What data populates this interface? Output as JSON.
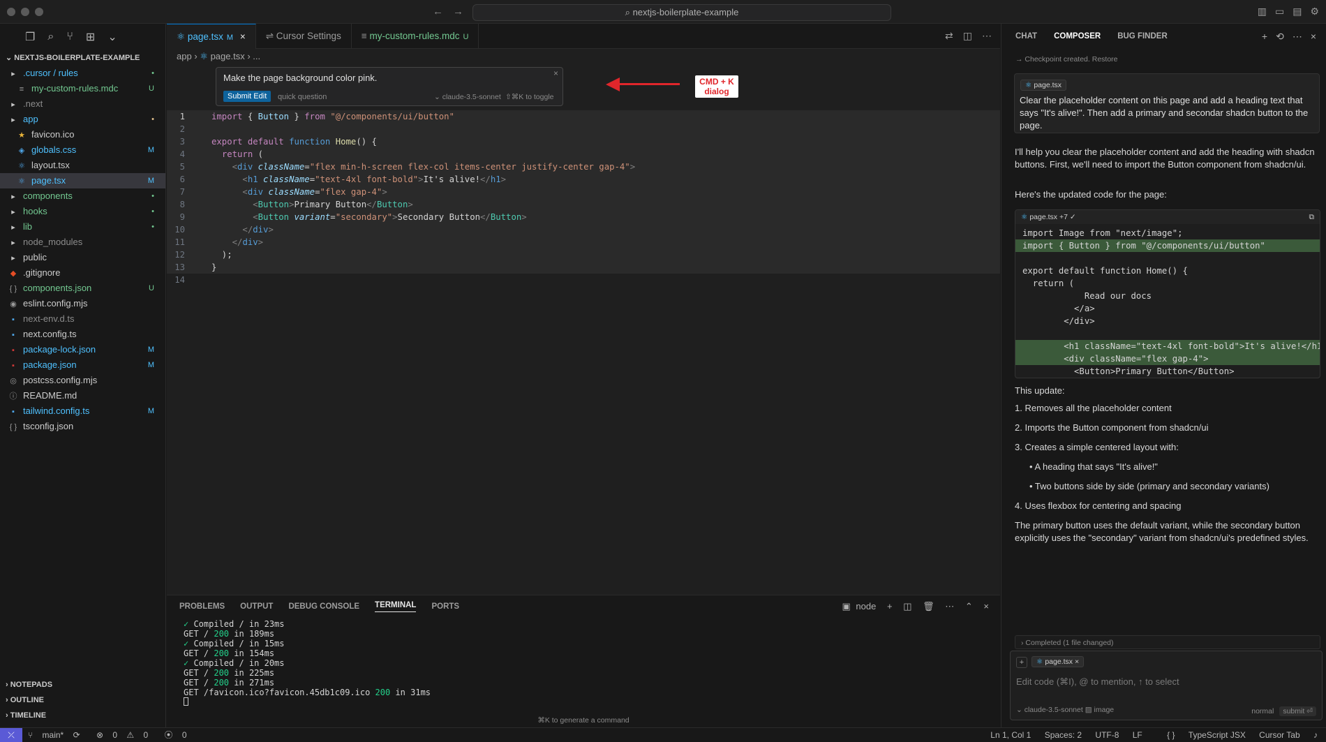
{
  "window": {
    "search_text": "nextjs-boilerplate-example"
  },
  "explorer": {
    "root": "NEXTJS-BOILERPLATE-EXAMPLE",
    "items": [
      {
        "name": ".cursor / rules",
        "indent": 0,
        "icon": "folder",
        "color": "#4fc1ff",
        "badge": "•",
        "bcolor": "#73c991"
      },
      {
        "name": "my-custom-rules.mdc",
        "indent": 1,
        "icon": "file",
        "color": "#73c991",
        "badge": "U",
        "bcolor": "#73c991"
      },
      {
        "name": ".next",
        "indent": 0,
        "icon": "folder",
        "color": "#8c8c8c",
        "badge": "",
        "bcolor": ""
      },
      {
        "name": "app",
        "indent": 0,
        "icon": "folder",
        "color": "#4fc1ff",
        "badge": "•",
        "bcolor": "#e2c08d"
      },
      {
        "name": "favicon.ico",
        "indent": 1,
        "icon": "star",
        "color": "#cccccc",
        "badge": "",
        "bcolor": ""
      },
      {
        "name": "globals.css",
        "indent": 1,
        "icon": "css",
        "color": "#4fc1ff",
        "badge": "M",
        "bcolor": "#4fc1ff"
      },
      {
        "name": "layout.tsx",
        "indent": 1,
        "icon": "react",
        "color": "#cccccc",
        "badge": "",
        "bcolor": ""
      },
      {
        "name": "page.tsx",
        "indent": 1,
        "icon": "react",
        "color": "#4fc1ff",
        "badge": "M",
        "bcolor": "#4fc1ff",
        "selected": true
      },
      {
        "name": "components",
        "indent": 0,
        "icon": "folder",
        "color": "#73c991",
        "badge": "•",
        "bcolor": "#73c991"
      },
      {
        "name": "hooks",
        "indent": 0,
        "icon": "folder",
        "color": "#73c991",
        "badge": "•",
        "bcolor": "#73c991"
      },
      {
        "name": "lib",
        "indent": 0,
        "icon": "folder",
        "color": "#73c991",
        "badge": "•",
        "bcolor": "#73c991"
      },
      {
        "name": "node_modules",
        "indent": 0,
        "icon": "folder",
        "color": "#8c8c8c",
        "badge": "",
        "bcolor": ""
      },
      {
        "name": "public",
        "indent": 0,
        "icon": "folder",
        "color": "#cccccc",
        "badge": "",
        "bcolor": ""
      },
      {
        "name": ".gitignore",
        "indent": 0,
        "icon": "git",
        "color": "#cccccc",
        "badge": "",
        "bcolor": ""
      },
      {
        "name": "components.json",
        "indent": 0,
        "icon": "json",
        "color": "#73c991",
        "badge": "U",
        "bcolor": "#73c991"
      },
      {
        "name": "eslint.config.mjs",
        "indent": 0,
        "icon": "eslint",
        "color": "#cccccc",
        "badge": "",
        "bcolor": ""
      },
      {
        "name": "next-env.d.ts",
        "indent": 0,
        "icon": "ts",
        "color": "#8c8c8c",
        "badge": "",
        "bcolor": ""
      },
      {
        "name": "next.config.ts",
        "indent": 0,
        "icon": "ts",
        "color": "#cccccc",
        "badge": "",
        "bcolor": ""
      },
      {
        "name": "package-lock.json",
        "indent": 0,
        "icon": "npm",
        "color": "#4fc1ff",
        "badge": "M",
        "bcolor": "#4fc1ff"
      },
      {
        "name": "package.json",
        "indent": 0,
        "icon": "npm",
        "color": "#4fc1ff",
        "badge": "M",
        "bcolor": "#4fc1ff"
      },
      {
        "name": "postcss.config.mjs",
        "indent": 0,
        "icon": "postcss",
        "color": "#cccccc",
        "badge": "",
        "bcolor": ""
      },
      {
        "name": "README.md",
        "indent": 0,
        "icon": "info",
        "color": "#cccccc",
        "badge": "",
        "bcolor": ""
      },
      {
        "name": "tailwind.config.ts",
        "indent": 0,
        "icon": "ts",
        "color": "#4fc1ff",
        "badge": "M",
        "bcolor": "#4fc1ff"
      },
      {
        "name": "tsconfig.json",
        "indent": 0,
        "icon": "json",
        "color": "#cccccc",
        "badge": "",
        "bcolor": ""
      }
    ],
    "sections": [
      "NOTEPADS",
      "OUTLINE",
      "TIMELINE"
    ]
  },
  "tabs": [
    {
      "label": "page.tsx",
      "status": "M",
      "active": true
    },
    {
      "label": "Cursor Settings",
      "status": ""
    },
    {
      "label": "my-custom-rules.mdc",
      "status": "U"
    }
  ],
  "breadcrumb": [
    "app",
    "page.tsx",
    "..."
  ],
  "cmdk": {
    "prompt": "Make the page background color pink.",
    "submit": "Submit Edit",
    "quick": "quick question",
    "model": "claude-3.5-sonnet",
    "toggle": "⇧⌘K to toggle",
    "annotation_line1": "CMD + K",
    "annotation_line2": "dialog"
  },
  "code_lines": [
    "<span class=\"k\">import</span> { <span class=\"v\">Button</span> } <span class=\"k\">from</span> <span class=\"s\">\"@/components/ui/button\"</span>",
    "",
    "<span class=\"k\">export</span> <span class=\"k\">default</span> <span class=\"kw\">function</span> <span class=\"f\">Home</span>() {",
    "  <span class=\"k\">return</span> (",
    "    <span class=\"p\">&lt;</span><span class=\"kw\">div</span> <span class=\"a\">className</span>=<span class=\"s\">\"flex min-h-screen flex-col items-center justify-center gap-4\"</span><span class=\"p\">&gt;</span>",
    "      <span class=\"p\">&lt;</span><span class=\"kw\">h1</span> <span class=\"a\">className</span>=<span class=\"s\">\"text-4xl font-bold\"</span><span class=\"p\">&gt;</span>It's alive!<span class=\"p\">&lt;/</span><span class=\"kw\">h1</span><span class=\"p\">&gt;</span>",
    "      <span class=\"p\">&lt;</span><span class=\"kw\">div</span> <span class=\"a\">className</span>=<span class=\"s\">\"flex gap-4\"</span><span class=\"p\">&gt;</span>",
    "        <span class=\"p\">&lt;</span><span class=\"t\">Button</span><span class=\"p\">&gt;</span>Primary Button<span class=\"p\">&lt;/</span><span class=\"t\">Button</span><span class=\"p\">&gt;</span>",
    "        <span class=\"p\">&lt;</span><span class=\"t\">Button</span> <span class=\"a\">variant</span>=<span class=\"s\">\"secondary\"</span><span class=\"p\">&gt;</span>Secondary Button<span class=\"p\">&lt;/</span><span class=\"t\">Button</span><span class=\"p\">&gt;</span>",
    "      <span class=\"p\">&lt;/</span><span class=\"kw\">div</span><span class=\"p\">&gt;</span>",
    "    <span class=\"p\">&lt;/</span><span class=\"kw\">div</span><span class=\"p\">&gt;</span>",
    "  );",
    "}",
    ""
  ],
  "panel": {
    "tabs": [
      "PROBLEMS",
      "OUTPUT",
      "DEBUG CONSOLE",
      "TERMINAL",
      "PORTS"
    ],
    "active": "TERMINAL",
    "shell": "node",
    "hint": "⌘K to generate a command",
    "terminal": [
      "<span class=\"g\">✓</span> Compiled / in 23ms",
      "GET / <span class=\"g\">200</span> in 189ms",
      "<span class=\"g\">✓</span> Compiled / in 15ms",
      "GET / <span class=\"g\">200</span> in 154ms",
      "<span class=\"g\">✓</span> Compiled / in 20ms",
      "GET / <span class=\"g\">200</span> in 225ms",
      "GET / <span class=\"g\">200</span> in 271ms",
      "GET /favicon.ico?favicon.45db1c09.ico <span class=\"g\">200</span> in 31ms"
    ]
  },
  "chat": {
    "tabs": [
      "CHAT",
      "COMPOSER",
      "BUG FINDER"
    ],
    "active": "COMPOSER",
    "checkpoint": "Checkpoint created.",
    "restore": "Restore",
    "user_file": "page.tsx",
    "user_msg": "Clear the placeholder content on this page and add a heading text that says \"It's alive!\". Then add a primary and secondar shadcn button to the page.",
    "reply1": "I'll help you clear the placeholder content and add the heading with shadcn buttons. First, we'll need to import the Button component from shadcn/ui.",
    "reply2": "Here's the updated code for the page:",
    "code_header": "page.tsx +7 ✓",
    "code": [
      {
        "t": "import Image from \"next/image\";",
        "add": false
      },
      {
        "t": "import { Button } from \"@/components/ui/button\"",
        "add": true
      },
      {
        "t": "",
        "add": false
      },
      {
        "t": "export default function Home() {",
        "add": false
      },
      {
        "t": "  return (",
        "add": false
      },
      {
        "t": "            Read our docs",
        "add": false
      },
      {
        "t": "          </a>",
        "add": false
      },
      {
        "t": "        </div>",
        "add": false
      },
      {
        "t": "",
        "add": false
      },
      {
        "t": "        <h1 className=\"text-4xl font-bold\">It's alive!</h1>",
        "add": true
      },
      {
        "t": "        <div className=\"flex gap-4\">",
        "add": true
      },
      {
        "t": "          <Button>Primary Button</Button>",
        "add": false
      }
    ],
    "update_title": "This update:",
    "list": [
      "1. Removes all the placeholder content",
      "2. Imports the Button component from shadcn/ui",
      "3. Creates a simple centered layout with:",
      "• A heading that says \"It's alive!\"",
      "• Two buttons side by side (primary and secondary variants)",
      "4. Uses flexbox for centering and spacing"
    ],
    "closing": "The primary button uses the default variant, while the secondary button explicitly uses the \"secondary\" variant from shadcn/ui's predefined styles.",
    "completed": "Completed (1 file changed)",
    "input_chip": "page.tsx",
    "placeholder": "Edit code (⌘I), @ to mention, ↑ to select",
    "model": "claude-3.5-sonnet",
    "image": "image",
    "mode": "normal",
    "submit": "submit ⏎"
  },
  "statusbar": {
    "branch": "main*",
    "errors": "0",
    "warnings": "0",
    "ports": "0",
    "position": "Ln 1, Col 1",
    "spaces": "Spaces: 2",
    "encoding": "UTF-8",
    "eol": "LF",
    "language": "TypeScript JSX",
    "tab": "Cursor Tab"
  }
}
